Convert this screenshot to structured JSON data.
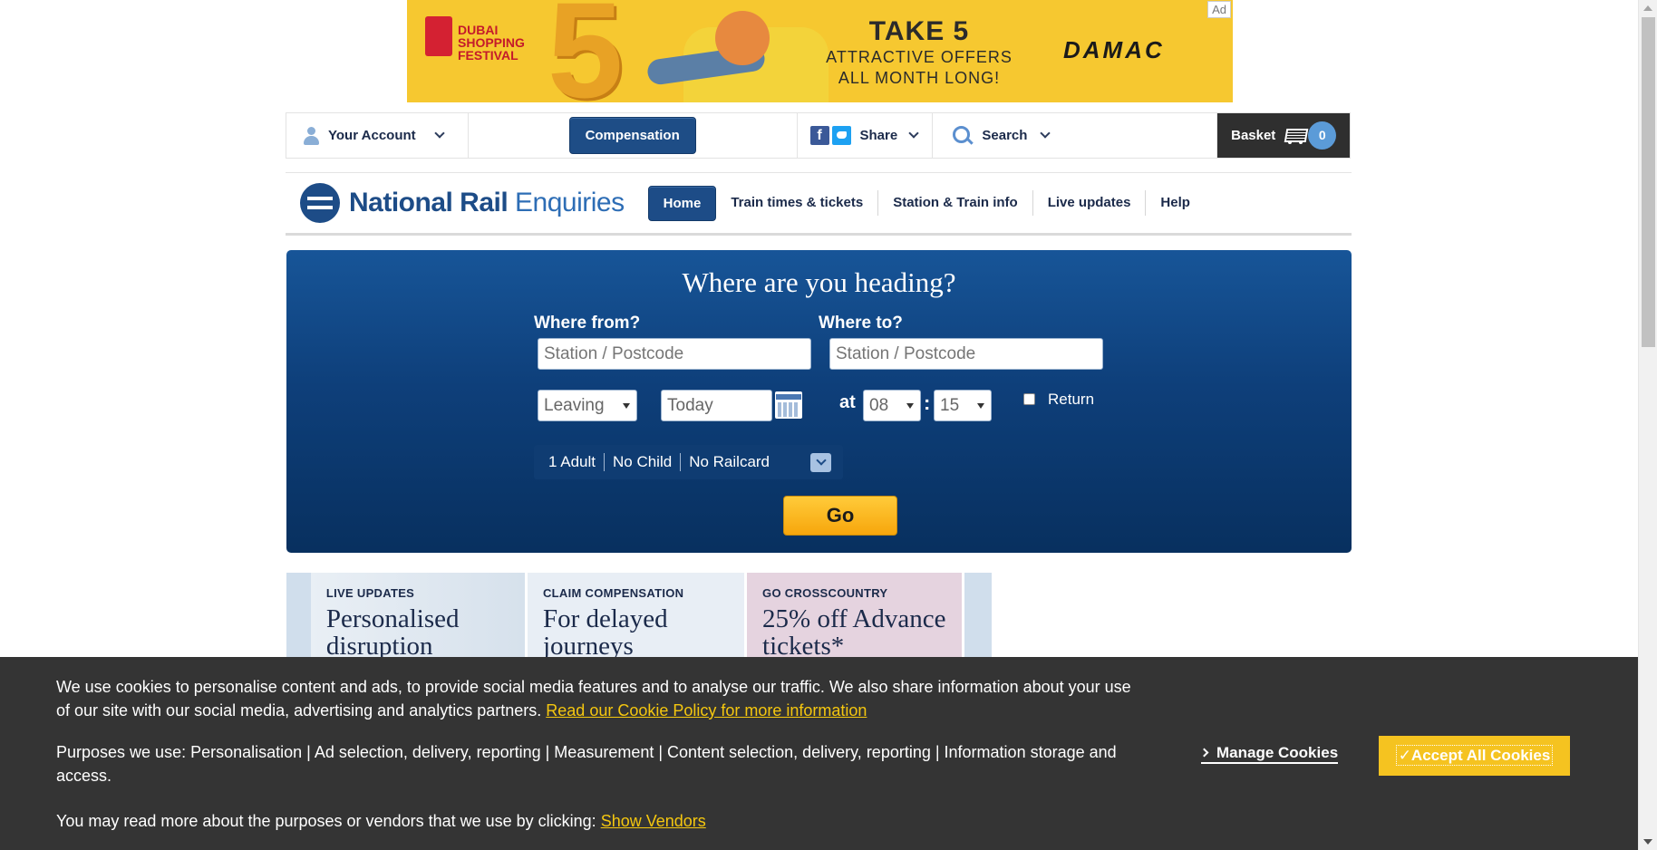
{
  "ad": {
    "tag": "Ad",
    "festival": "DUBAI SHOPPING FESTIVAL",
    "headline": "TAKE 5",
    "subline_1": "ATTRACTIVE OFFERS",
    "subline_2": "ALL MONTH LONG!",
    "brand": "DAMAC",
    "bg_color": "#f6c830"
  },
  "utility_bar": {
    "account_label": "Your Account",
    "compensation_label": "Compensation",
    "share_label": "Share",
    "search_label": "Search",
    "basket_label": "Basket",
    "basket_count": "0"
  },
  "nav": {
    "logo_bold": "National Rail",
    "logo_light": "Enquiries",
    "home": "Home",
    "links": [
      "Train times & tickets",
      "Station & Train info",
      "Live updates",
      "Help"
    ]
  },
  "planner": {
    "title": "Where are you heading?",
    "from_label": "Where from?",
    "from_placeholder": "Station / Postcode",
    "to_label": "Where to?",
    "to_placeholder": "Station / Postcode",
    "leaving": "Leaving",
    "date_value": "Today",
    "at_label": "at",
    "hour": "08",
    "minute": "15",
    "return_label": "Return",
    "passengers": [
      "1 Adult",
      "No Child",
      "No Railcard"
    ],
    "go_label": "Go"
  },
  "promos": [
    {
      "kicker": "LIVE UPDATES",
      "headline": "Personalised disruption"
    },
    {
      "kicker": "CLAIM COMPENSATION",
      "headline": "For delayed journeys"
    },
    {
      "kicker": "GO CROSSCOUNTRY",
      "headline": "25% off Advance tickets*"
    }
  ],
  "cookie": {
    "text_1": "We use cookies to personalise content and ads, to provide social media features and to analyse our traffic. We also share information about your use of our site with our social media, advertising and analytics partners.",
    "policy_link": "Read our Cookie Policy for more information",
    "text_2": "Purposes we use: Personalisation | Ad selection, delivery, reporting | Measurement | Content selection, delivery, reporting | Information storage and access.",
    "text_3": "You may read more about the purposes or vendors that we use by clicking:",
    "vendors_link": "Show Vendors",
    "manage_label": "Manage Cookies",
    "accept_label": "✓Accept All Cookies",
    "accent_color": "#f5c320"
  },
  "colors": {
    "brand_blue": "#1d4c87",
    "go_yellow": "#f7a60c",
    "banner_bg": "#343434"
  }
}
